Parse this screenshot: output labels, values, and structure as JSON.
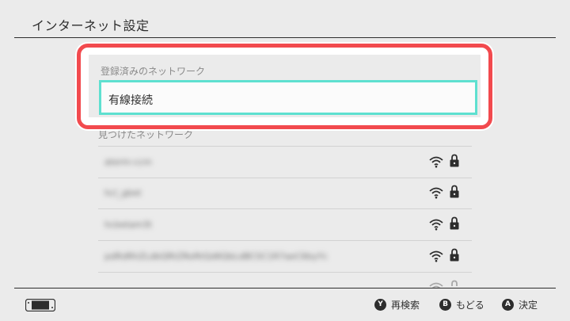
{
  "header": {
    "title": "インターネット設定"
  },
  "registered": {
    "section_label": "登録済みのネットワーク",
    "items": [
      {
        "label": "有線接続"
      }
    ]
  },
  "found": {
    "section_label": "見つけたネットワーク",
    "networks": [
      {
        "name": "aterm-ccm",
        "icon": "wifi-icon",
        "locked": true
      },
      {
        "name": "hcl_gbet",
        "icon": "wifi-icon",
        "locked": true
      },
      {
        "name": "hcbetam3t",
        "icon": "wifi-icon",
        "locked": true
      },
      {
        "name": "pdRdRhZLdbQRtZRoRtQd6QbLdBCSC1R7aeC6byYc",
        "icon": "wifi-icon",
        "locked": true
      },
      {
        "name": "",
        "icon": "wifi-icon",
        "locked": true
      }
    ]
  },
  "footer": {
    "hints": [
      {
        "button": "Y",
        "label": "再検索"
      },
      {
        "button": "B",
        "label": "もどる"
      },
      {
        "button": "A",
        "label": "決定"
      }
    ]
  },
  "colors": {
    "highlight": "#f24a4e",
    "focus": "#5ee0d0",
    "background": "#ebebeb"
  }
}
